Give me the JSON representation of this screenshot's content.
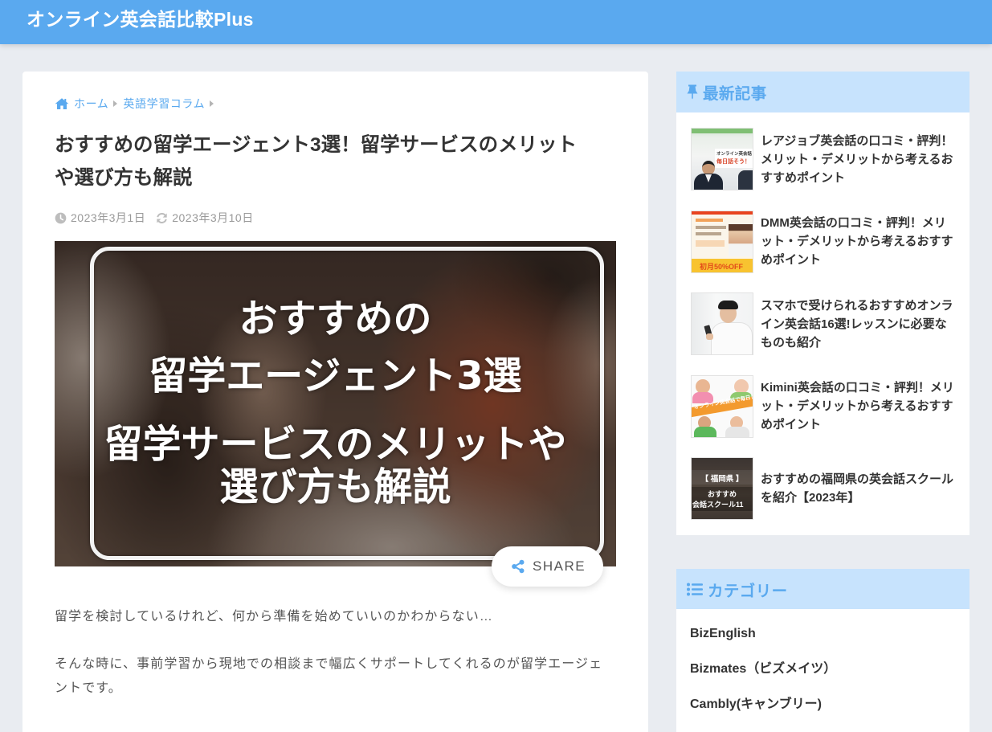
{
  "site": {
    "title": "オンライン英会話比較Plus"
  },
  "theme": {
    "brand": "#5aa9ef",
    "widget_header_bg": "#c7e3fd",
    "page_bg": "#e9ecf1",
    "text": "#333333"
  },
  "breadcrumb": [
    {
      "label": "ホーム",
      "icon": "home-icon"
    },
    {
      "label": "英語学習コラム"
    }
  ],
  "article": {
    "title_lines": [
      "おすすめの留学エージェント3選！留学サービスのメリット",
      "や選び方も解説"
    ],
    "published": "2023年3月1日",
    "published_icon": "clock-icon",
    "updated": "2023年3月10日",
    "updated_icon": "refresh-icon",
    "hero_lines": [
      "おすすめの",
      "留学エージェント3選",
      "留学サービスのメリットや",
      "選び方も解説"
    ],
    "share": {
      "label": "SHARE",
      "icon": "share-icon"
    },
    "paragraphs": [
      [
        "留学を検討しているけれど、何から準備を始めていいのかわからない…"
      ],
      [
        "そんな時に、事前学習から現地での相談まで幅広くサポートしてくれるのが留学エージェ",
        "ントです。"
      ]
    ]
  },
  "sidebar": {
    "recent": {
      "heading": "最新記事",
      "icon": "thumbtack-icon",
      "items": [
        {
          "title_lines": [
            "レアジョブ英会話の口コミ・評判！",
            "メリット・デメリットから考えるお",
            "すすめポイント"
          ],
          "thumb_text": [
            "オンライン英会話",
            "毎日話そう！"
          ]
        },
        {
          "title_lines": [
            "DMM英会話の口コミ・評判！メリ",
            "ット・デメリットから考えるおすす",
            "めポイント"
          ],
          "thumb_text": [
            "初月50%OFF"
          ]
        },
        {
          "title_lines": [
            "スマホで受けられるおすすめオンラ",
            "イン英会話16選!レッスンに必要な",
            "ものも紹介"
          ],
          "thumb_text": []
        },
        {
          "title_lines": [
            "Kimini英会話の口コミ・評判！メリ",
            "ット・デメリットから考えるおすす",
            "めポイント"
          ],
          "thumb_text": [
            "オンライン英会話で毎日レッ"
          ]
        },
        {
          "title_lines": [
            "おすすめの福岡県の英会話スクール",
            "を紹介【2023年】"
          ],
          "thumb_text": [
            "【 福岡県 】",
            "おすすめ",
            "会話スクール11"
          ]
        }
      ]
    },
    "categories": {
      "heading": "カテゴリー",
      "icon": "list-icon",
      "items": [
        "BizEnglish",
        "Bizmates（ビズメイツ）",
        "Cambly(キャンブリー)"
      ]
    }
  }
}
